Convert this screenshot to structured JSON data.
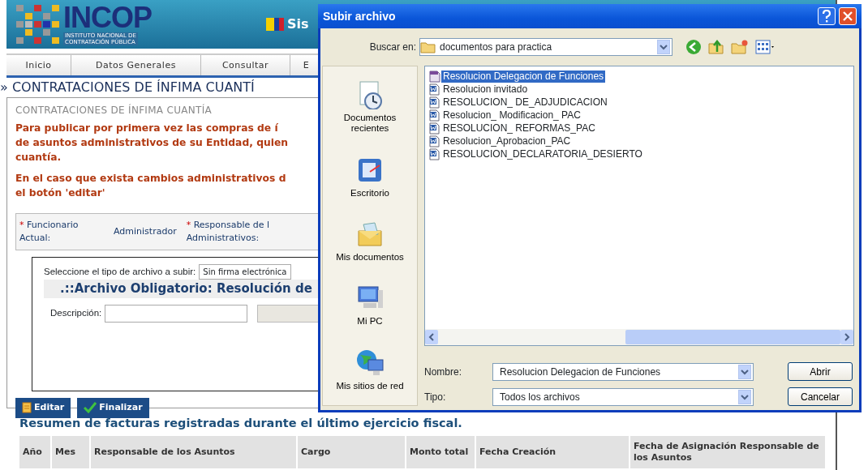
{
  "header": {
    "logo_title": "INCOP",
    "logo_subtitle": [
      "INSTITUTO NACIONAL DE",
      "CONTRATACIÓN PÚBLICA"
    ],
    "system_text": "Sis"
  },
  "nav": [
    {
      "label": "Inicio"
    },
    {
      "label": "Datos Generales"
    },
    {
      "label": "Consultar"
    },
    {
      "label": "E"
    }
  ],
  "page_title": "» CONTRATACIONES DE ÍNFIMA CUANTÍ",
  "panel": {
    "heading": "CONTRATACIONES DE ÍNFIMA CUANTÍA",
    "notices": [
      [
        "Para publicar por primera vez las compras de í",
        "de asuntos administrativos de su Entidad, quien",
        "cuantía."
      ],
      [
        "En el caso que exista cambios administrativos d",
        "el botón 'editar'"
      ]
    ],
    "form": [
      {
        "required_mark": "*",
        "label": "Funcionario Actual:",
        "value": "Administrador"
      },
      {
        "required_mark": "*",
        "label": "Responsable de l Administrativos:"
      }
    ],
    "upload": {
      "select_label": "Seleccione el tipo de archivo a subir:",
      "select_value": "Sin firma electrónica",
      "section_title": ".::Archivo Obligatorio: Resolución de",
      "description_label": "Descripción:"
    },
    "buttons": [
      {
        "label": "Editar",
        "kind": "edit"
      },
      {
        "label": "Finalizar",
        "kind": "finish"
      }
    ]
  },
  "summary": {
    "title": "Resumen de facturas registradas durante el último ejercicio fiscal.",
    "columns": [
      "Año",
      "Mes",
      "Responsable de los Asuntos",
      "Cargo",
      "Monto total",
      "Fecha Creación",
      "Fecha de Asignación Responsable de los Asuntos"
    ]
  },
  "dialog": {
    "title": "Subir archivo",
    "look_in_label": "Buscar en:",
    "look_in_value": "documentos para practica",
    "places": [
      {
        "label": "Documentos recientes",
        "kind": "recent"
      },
      {
        "label": "Escritorio",
        "kind": "desktop"
      },
      {
        "label": "Mis documentos",
        "kind": "documents"
      },
      {
        "label": "Mi PC",
        "kind": "computer"
      },
      {
        "label": "Mis sitios de red",
        "kind": "network"
      }
    ],
    "files": [
      {
        "name": "Resolucion Delegacion de Funciones",
        "kind": "other",
        "selected": true
      },
      {
        "name": "Resolucion invitado",
        "kind": "word",
        "selected": false
      },
      {
        "name": "RESOLUCION_ DE_ADJUDICACION",
        "kind": "word",
        "selected": false
      },
      {
        "name": "Resolucion_ Modificacion_ PAC",
        "kind": "word",
        "selected": false
      },
      {
        "name": "RESOLUCION_ REFORMAS_PAC",
        "kind": "word",
        "selected": false
      },
      {
        "name": "Resolucion_Aprobacion_PAC",
        "kind": "word",
        "selected": false
      },
      {
        "name": "RESOLUCION_DECLARATORIA_DESIERTO",
        "kind": "word",
        "selected": false
      }
    ],
    "filename_label": "Nombre:",
    "filename_value": "Resolucion Delegacion de Funciones",
    "type_label": "Tipo:",
    "type_value": "Todos los archivos",
    "buttons": [
      "Abrir",
      "Cancelar"
    ]
  }
}
